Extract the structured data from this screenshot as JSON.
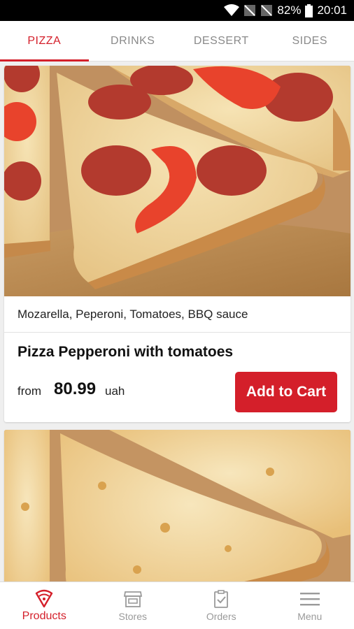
{
  "status_bar": {
    "battery": "82%",
    "time": "20:01"
  },
  "tabs": [
    {
      "label": "PIZZA",
      "active": true
    },
    {
      "label": "DRINKS",
      "active": false
    },
    {
      "label": "DESSERT",
      "active": false
    },
    {
      "label": "SIDES",
      "active": false
    }
  ],
  "products": [
    {
      "ingredients": "Mozarella, Peperoni, Tomatoes, BBQ sauce",
      "name": "Pizza Pepperoni with tomatoes",
      "price_prefix": "from",
      "price": "80.99",
      "currency": "uah",
      "cart_label": "Add to Cart",
      "image_icon": "pepperoni-pizza-photo"
    },
    {
      "image_icon": "cheese-pizza-photo"
    }
  ],
  "bottom_nav": [
    {
      "label": "Products",
      "icon": "pizza-slice-icon",
      "active": true
    },
    {
      "label": "Stores",
      "icon": "store-icon",
      "active": false
    },
    {
      "label": "Orders",
      "icon": "clipboard-check-icon",
      "active": false
    },
    {
      "label": "Menu",
      "icon": "hamburger-menu-icon",
      "active": false
    }
  ],
  "colors": {
    "accent": "#d41f2a",
    "inactive": "#8a8a8a"
  }
}
